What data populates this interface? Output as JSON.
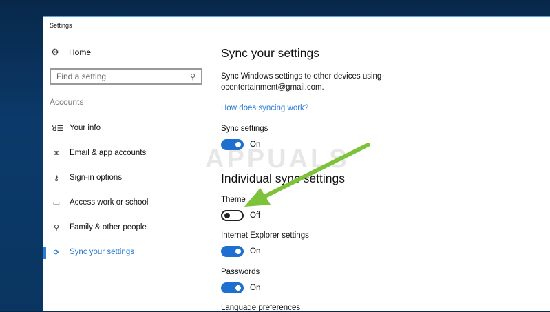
{
  "window": {
    "title": "Settings"
  },
  "sidebar": {
    "home": {
      "label": "Home",
      "icon": "gear-icon"
    },
    "search": {
      "placeholder": "Find a setting",
      "icon": "search-icon"
    },
    "section": "Accounts",
    "items": [
      {
        "label": "Your info",
        "icon": "person-card-icon"
      },
      {
        "label": "Email & app accounts",
        "icon": "mail-icon"
      },
      {
        "label": "Sign-in options",
        "icon": "key-icon"
      },
      {
        "label": "Access work or school",
        "icon": "briefcase-icon"
      },
      {
        "label": "Family & other people",
        "icon": "people-icon"
      },
      {
        "label": "Sync your settings",
        "icon": "sync-icon",
        "active": true
      }
    ]
  },
  "main": {
    "title": "Sync your settings",
    "description": "Sync Windows settings to other devices using ocentertainment@gmail.com.",
    "link": "How does syncing work?",
    "sync": {
      "label": "Sync settings",
      "state": "On"
    },
    "individual_title": "Individual sync settings",
    "settings": [
      {
        "label": "Theme",
        "state": "Off"
      },
      {
        "label": "Internet Explorer settings",
        "state": "On"
      },
      {
        "label": "Passwords",
        "state": "On"
      },
      {
        "label": "Language preferences"
      }
    ]
  },
  "watermark": "APPUALS",
  "colors": {
    "accent": "#2b7cd3",
    "toggle_on": "#1e6fd0",
    "arrow": "#7cc23a"
  }
}
